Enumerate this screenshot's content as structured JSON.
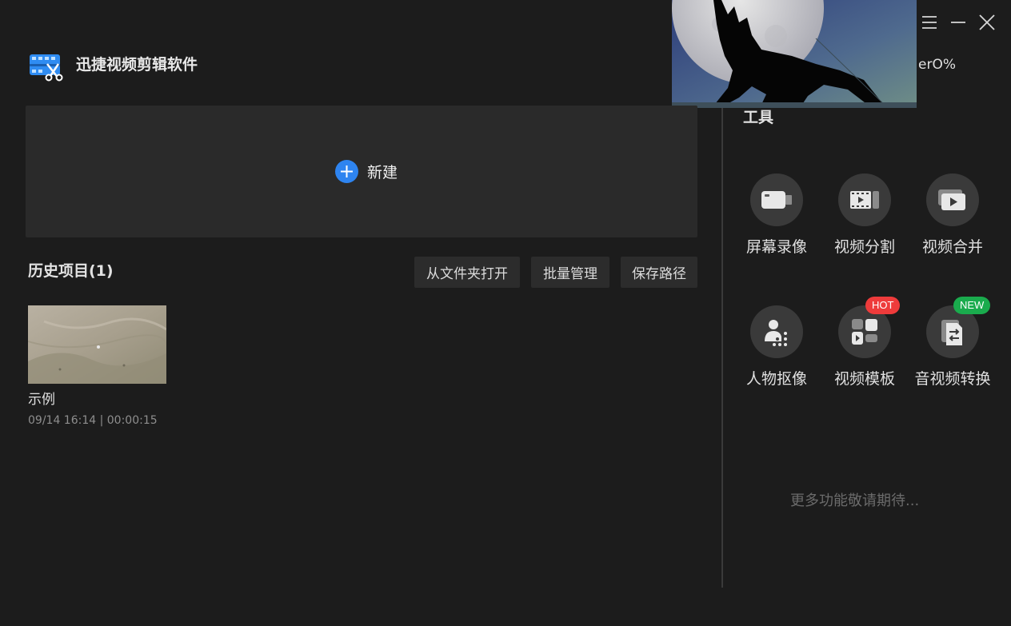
{
  "app": {
    "title": "迅捷视频剪辑软件"
  },
  "overlay": {
    "text": "erO%"
  },
  "new_project": {
    "label": "新建"
  },
  "history": {
    "title": "历史项目(1)",
    "buttons": {
      "open_folder": "从文件夹打开",
      "batch_manage": "批量管理",
      "save_path": "保存路径"
    },
    "projects": [
      {
        "name": "示例",
        "meta": "09/14 16:14 | 00:00:15"
      }
    ]
  },
  "tools": {
    "title": "工具",
    "items": [
      {
        "label": "屏幕录像",
        "icon": "camera-icon"
      },
      {
        "label": "视频分割",
        "icon": "film-split-icon"
      },
      {
        "label": "视频合并",
        "icon": "video-merge-icon"
      },
      {
        "label": "人物抠像",
        "icon": "portrait-cutout-icon"
      },
      {
        "label": "视频模板",
        "icon": "template-grid-icon",
        "badge": "HOT"
      },
      {
        "label": "音视频转换",
        "icon": "file-convert-icon",
        "badge": "NEW"
      }
    ],
    "more": "更多功能敬请期待..."
  },
  "colors": {
    "accent": "#2e84f0",
    "hot": "#ee3b3b",
    "new": "#1aab4d",
    "background": "#1c1c1c",
    "panel": "#2a2a2a"
  }
}
